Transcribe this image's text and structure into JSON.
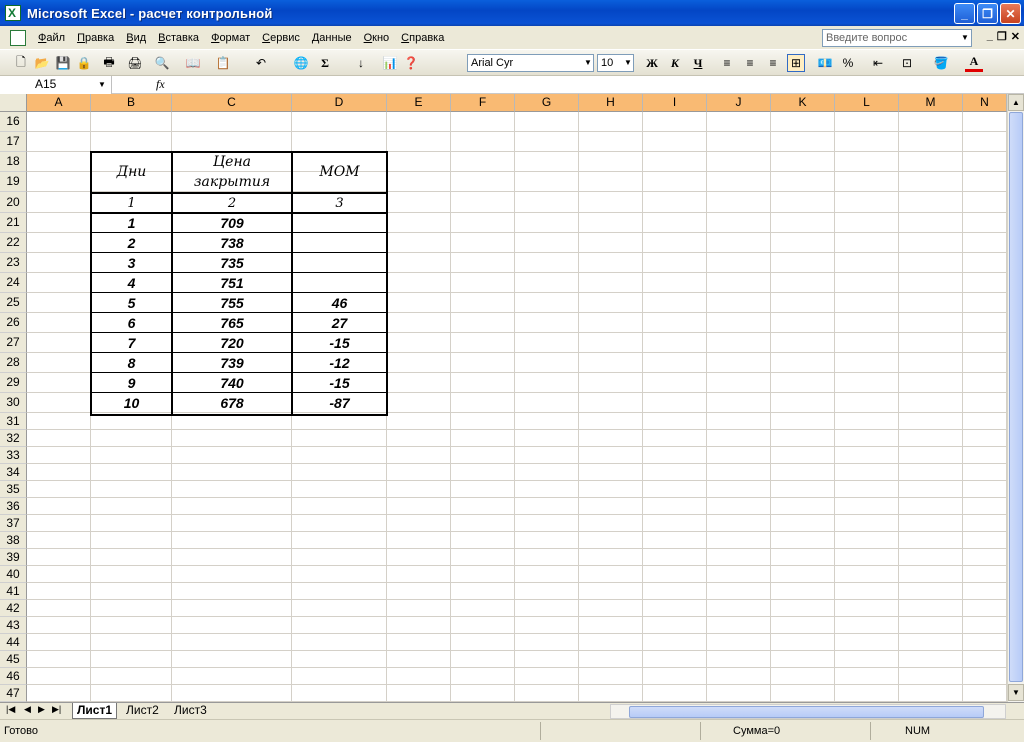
{
  "window": {
    "title": "Microsoft Excel - расчет контрольной"
  },
  "menu": [
    "Файл",
    "Правка",
    "Вид",
    "Вставка",
    "Формат",
    "Сервис",
    "Данные",
    "Окно",
    "Справка"
  ],
  "help": {
    "placeholder": "Введите вопрос"
  },
  "toolbar": {
    "font": "Arial Cyr",
    "size": "10",
    "bold": "Ж",
    "italic": "К",
    "underline": "Ч",
    "sum": "Σ",
    "percent": "%",
    "fontcolor": "A"
  },
  "formula": {
    "name_box": "A15",
    "fx": "fx"
  },
  "columns": [
    "A",
    "B",
    "C",
    "D",
    "E",
    "F",
    "G",
    "H",
    "I",
    "J",
    "K",
    "L",
    "M",
    "N"
  ],
  "rows": [
    16,
    17,
    18,
    19,
    20,
    21,
    22,
    23,
    24,
    25,
    26,
    27,
    28,
    29,
    30,
    31,
    32,
    33,
    34,
    35,
    36,
    37,
    38,
    39,
    40,
    41,
    42,
    43,
    44,
    45,
    46,
    47
  ],
  "table": {
    "headers": {
      "days": "Дни",
      "price_1": "Цена",
      "price_2": "закрытия",
      "mom": "MOM"
    },
    "index_row": [
      "1",
      "2",
      "3"
    ],
    "data": [
      [
        "1",
        "709",
        ""
      ],
      [
        "2",
        "738",
        ""
      ],
      [
        "3",
        "735",
        ""
      ],
      [
        "4",
        "751",
        ""
      ],
      [
        "5",
        "755",
        "46"
      ],
      [
        "6",
        "765",
        "27"
      ],
      [
        "7",
        "720",
        "-15"
      ],
      [
        "8",
        "739",
        "-12"
      ],
      [
        "9",
        "740",
        "-15"
      ],
      [
        "10",
        "678",
        "-87"
      ]
    ]
  },
  "sheets": [
    "Лист1",
    "Лист2",
    "Лист3"
  ],
  "status": {
    "text": "Готово",
    "sum": "Сумма=0",
    "num": "NUM"
  }
}
